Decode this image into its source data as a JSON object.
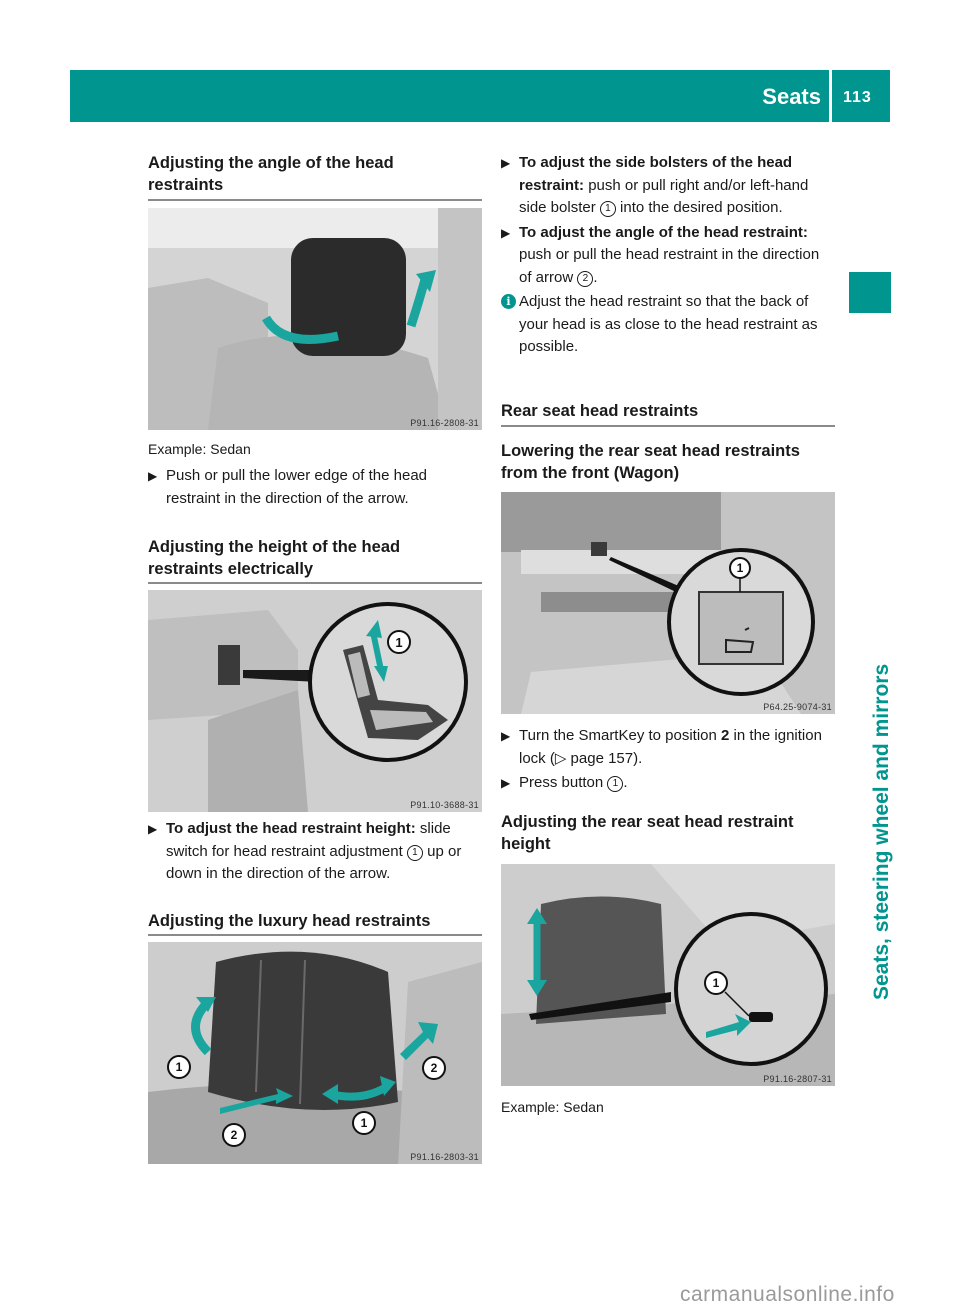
{
  "header": {
    "section_title": "Seats",
    "page_number": "113",
    "accent_color": "#00968f"
  },
  "side_tab": {
    "chapter_label": "Seats, steering wheel and mirrors"
  },
  "left_column": {
    "section1": {
      "heading": "Adjusting the angle of the head restraints",
      "figure_code": "P91.16-2808-31",
      "caption": "Example: Sedan",
      "step": "Push or pull the lower edge of the head restraint in the direction of the arrow."
    },
    "section2": {
      "heading": "Adjusting the height of the head restraints electrically",
      "figure_code": "P91.10-3688-31",
      "figure_callout": "1",
      "step_bold": "To adjust the head restraint height:",
      "step_text_a": " slide switch for head restraint adjustment ",
      "step_callout": "1",
      "step_text_b": " up or down in the direction of the arrow."
    },
    "section3": {
      "heading": "Adjusting the luxury head restraints",
      "figure_code": "P91.16-2803-31",
      "figure_callouts": [
        "1",
        "2",
        "2",
        "1"
      ]
    }
  },
  "right_column": {
    "steps_luxury": [
      {
        "bold": "To adjust the side bolsters of the head restraint:",
        "text_a": " push or pull right and/or left-hand side bolster ",
        "callout": "1",
        "text_b": " into the desired position."
      },
      {
        "bold": "To adjust the angle of the head restraint:",
        "text_a": " push or pull the head restraint in the direction of arrow ",
        "callout": "2",
        "text_b": "."
      }
    ],
    "info_note": "Adjust the head restraint so that the back of your head is as close to the head restraint as possible.",
    "section_rear": {
      "heading": "Rear seat head restraints"
    },
    "subsection_lowering": {
      "heading": "Lowering the rear seat head restraints from the front (Wagon)",
      "figure_code": "P64.25-9074-31",
      "figure_callout": "1",
      "step1_text_a": "Turn the SmartKey to position ",
      "step1_bold": "2",
      "step1_text_b": " in the ignition lock (",
      "step1_ref_symbol": "▷",
      "step1_ref": " page 157).",
      "step2_text_a": "Press button ",
      "step2_callout": "1",
      "step2_text_b": "."
    },
    "subsection_height": {
      "heading": "Adjusting the rear seat head restraint height",
      "figure_code": "P91.16-2807-31",
      "figure_callout": "1",
      "caption": "Example: Sedan"
    }
  },
  "watermark": "carmanualsonline.info"
}
